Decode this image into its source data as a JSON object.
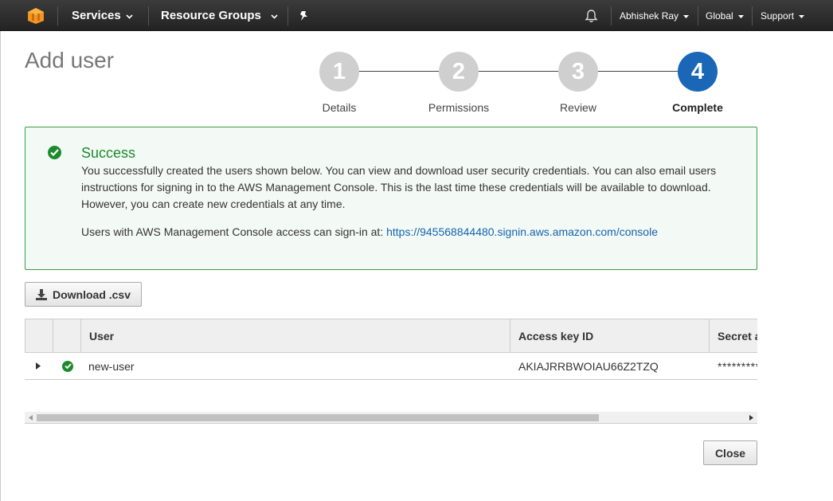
{
  "nav": {
    "services": "Services",
    "resource_groups": "Resource Groups",
    "user": "Abhishek Ray",
    "region": "Global",
    "support": "Support"
  },
  "page": {
    "title": "Add user"
  },
  "steps": [
    {
      "number": "1",
      "label": "Details"
    },
    {
      "number": "2",
      "label": "Permissions"
    },
    {
      "number": "3",
      "label": "Review"
    },
    {
      "number": "4",
      "label": "Complete"
    }
  ],
  "success": {
    "title": "Success",
    "message": "You successfully created the users shown below. You can view and download user security credentials. You can also email users instructions for signing in to the AWS Management Console. This is the last time these credentials will be available to download. However, you can create new credentials at any time.",
    "signin_prefix": "Users with AWS Management Console access can sign-in at: ",
    "signin_url": "https://945568844480.signin.aws.amazon.com/console"
  },
  "download_label": "Download .csv",
  "table": {
    "columns": [
      "User",
      "Access key ID",
      "Secret a"
    ],
    "rows": [
      {
        "user": "new-user",
        "access_key_id": "AKIAJRRBWOIAU66Z2TZQ",
        "secret": "**********"
      }
    ]
  },
  "close_label": "Close",
  "colors": {
    "accent": "#1a67b7",
    "success": "#1d8a2e",
    "link": "#1462b0"
  }
}
